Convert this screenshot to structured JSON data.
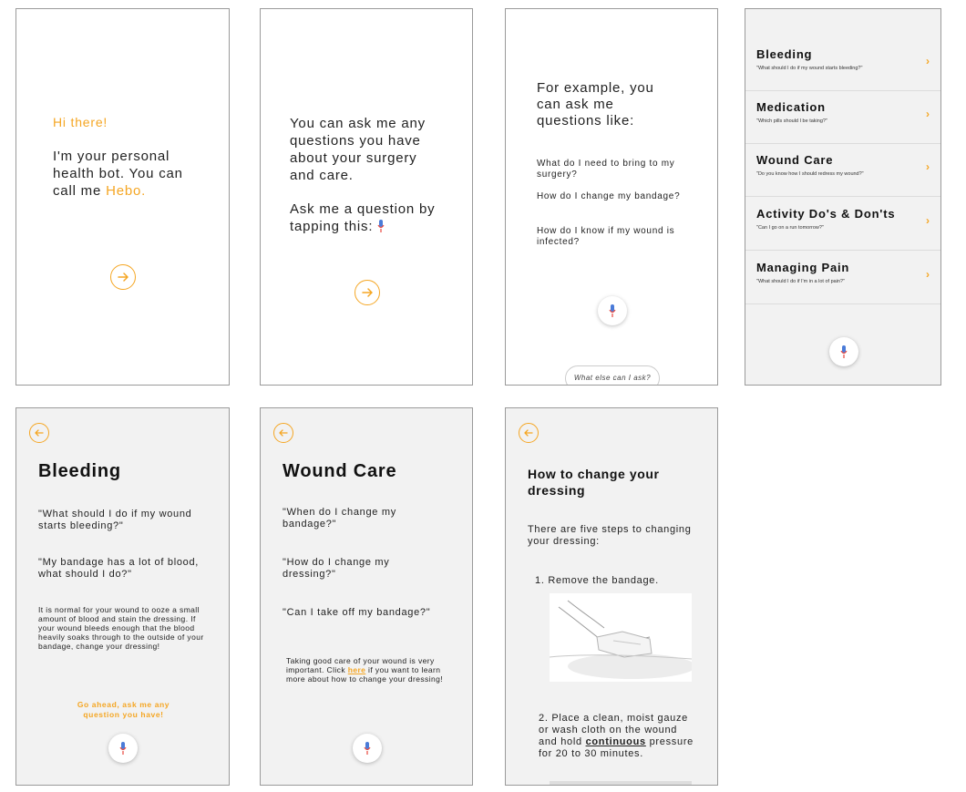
{
  "screen1": {
    "greeting": "Hi there!",
    "intro_prefix": "I'm your personal health bot. You can call me ",
    "bot_name": "Hebo."
  },
  "screen2": {
    "line1": "You can ask me any questions you have about your surgery and care.",
    "line2": "Ask me a question by tapping this:"
  },
  "screen3": {
    "intro": "For example, you can ask me questions like:",
    "questions": [
      "What do I need to bring to my surgery?",
      "How do I change my bandage?",
      "How do I know if my wound is infected?"
    ],
    "pill_label": "What else can I ask?"
  },
  "screen4": {
    "categories": [
      {
        "title": "Bleeding",
        "subtitle": "\"What should I do if my wound starts bleeding?\""
      },
      {
        "title": "Medication",
        "subtitle": "\"Which pills should I be taking?\""
      },
      {
        "title": "Wound Care",
        "subtitle": "\"Do you know how I should redress my wound?\""
      },
      {
        "title": "Activity Do's & Don'ts",
        "subtitle": "\"Can I go on a run tomorrow?\""
      },
      {
        "title": "Managing Pain",
        "subtitle": "\"What should I do if I'm in a lot of pain?\""
      }
    ],
    "chevron": "›"
  },
  "screen5": {
    "title": "Bleeding",
    "quote1": "\"What should I do if my wound starts bleeding?\"",
    "quote2": "\"My bandage has a lot of blood, what should I do?\"",
    "info": "It is normal for your wound to ooze a small amount of blood and stain the dressing. If your wound bleeds enough that the blood heavily soaks through to the outside of your bandage, change your dressing!",
    "ask": "Go ahead, ask me any question you have!"
  },
  "screen6": {
    "title": "Wound Care",
    "quote1": "\"When do I change my bandage?\"",
    "quote2": "\"How do I change my dressing?\"",
    "quote3": "\"Can I take off my bandage?\"",
    "info_prefix": "Taking good care of your wound is very important. Click ",
    "info_link": "here",
    "info_suffix": " if you want to learn more about how to change your dressing!"
  },
  "screen7": {
    "title": "How to change your dressing",
    "intro": "There are five steps to changing your dressing:",
    "step1": "1. Remove the bandage.",
    "step2_prefix": "2. Place a clean, moist gauze or wash cloth on the wound and hold ",
    "step2_bold": "continuous",
    "step2_suffix": " pressure for 20 to 30 minutes."
  },
  "colors": {
    "accent": "#f5a623",
    "screen_bg_grey": "#f2f2f2",
    "mic_blue": "#4a7bd8",
    "mic_red": "#e8453c"
  }
}
